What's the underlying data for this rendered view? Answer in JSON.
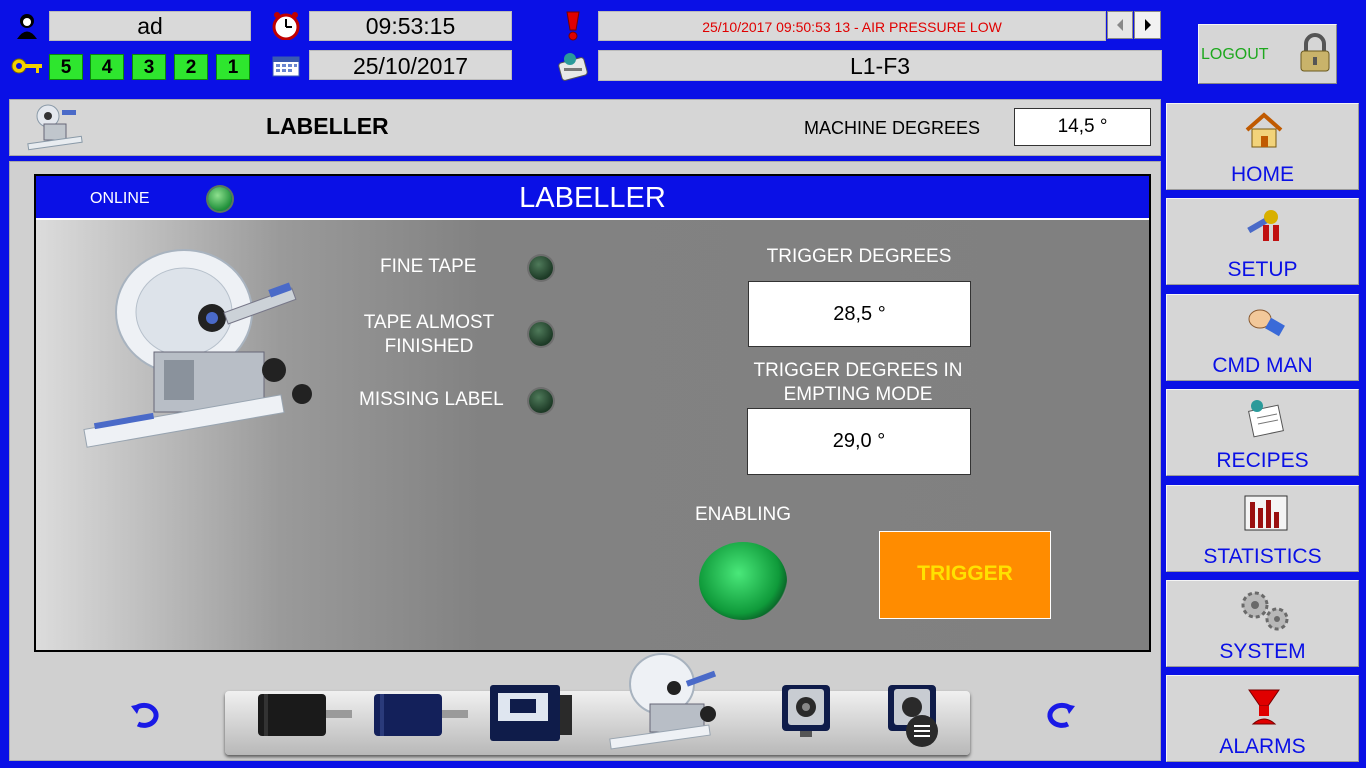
{
  "header": {
    "user": "ad",
    "time": "09:53:15",
    "date": "25/10/2017",
    "alarm_message": "25/10/2017 09:50:53 13 - AIR PRESSURE LOW",
    "line": "L1-F3",
    "access_levels": [
      "5",
      "4",
      "3",
      "2",
      "1"
    ],
    "logout_label": "LOGOUT"
  },
  "page": {
    "title": "LABELLER",
    "machine_degrees_label": "MACHINE DEGREES",
    "machine_degrees_value": "14,5 °"
  },
  "panel": {
    "title": "LABELLER",
    "online_label": "ONLINE",
    "fine_tape": "FINE TAPE",
    "tape_almost_finished_line1": "TAPE ALMOST",
    "tape_almost_finished_line2": "FINISHED",
    "missing_label": "MISSING LABEL",
    "trigger_degrees_label": "TRIGGER DEGREES",
    "trigger_degrees_value": "28,5 °",
    "trigger_empting_label_line1": "TRIGGER DEGREES IN",
    "trigger_empting_label_line2": "EMPTING MODE",
    "trigger_empting_value": "29,0 °",
    "enabling_label": "ENABLING",
    "trigger_button": "TRIGGER"
  },
  "nav": [
    {
      "label": "HOME",
      "icon": "home-icon"
    },
    {
      "label": "SETUP",
      "icon": "tools-icon"
    },
    {
      "label": "CMD MAN",
      "icon": "hand-icon"
    },
    {
      "label": "RECIPES",
      "icon": "recipe-icon"
    },
    {
      "label": "STATISTICS",
      "icon": "chart-icon"
    },
    {
      "label": "SYSTEM",
      "icon": "gears-icon"
    },
    {
      "label": "ALARMS",
      "icon": "siren-icon"
    }
  ],
  "colors": {
    "background": "#0a10e6",
    "level_green": "#2ee62e",
    "trigger_orange": "#ff8c00",
    "trigger_text": "#ffe100",
    "alarm_text": "#e00000"
  }
}
